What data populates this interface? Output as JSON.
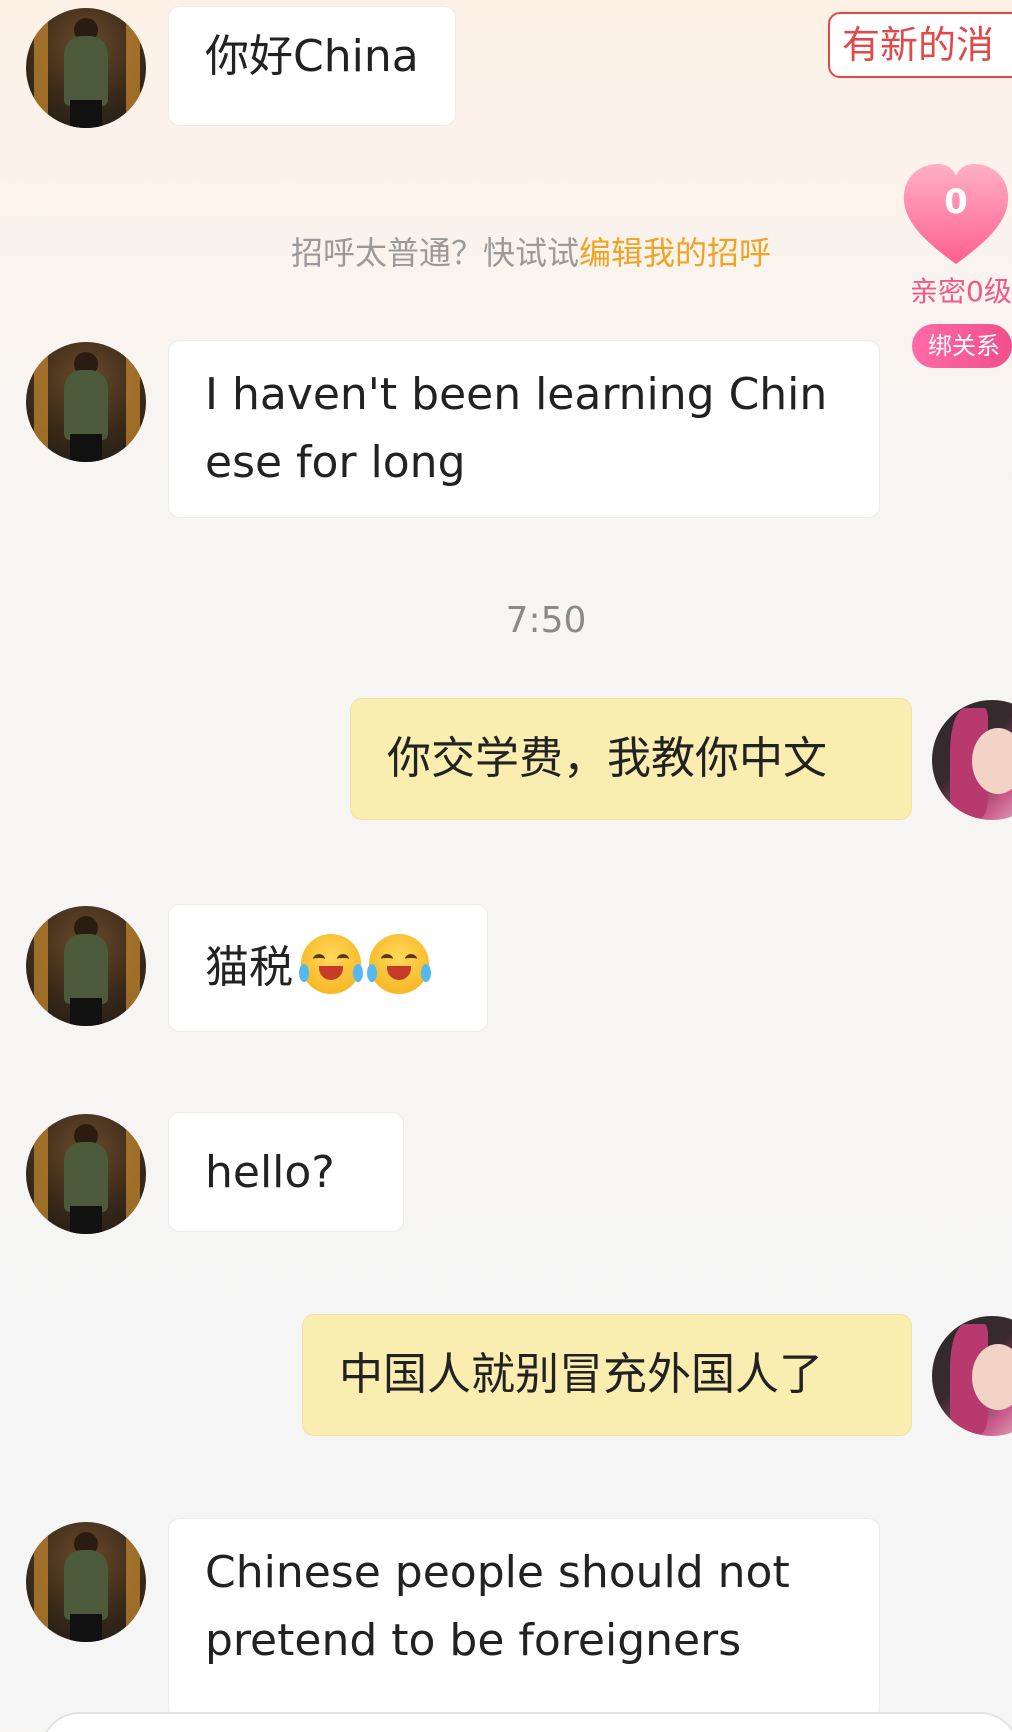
{
  "top_badge": {
    "label": "有新的消"
  },
  "greeting_hint": {
    "prefix": "招呼太普通？快试试",
    "link": "编辑我的招呼"
  },
  "intimacy": {
    "heart_value": "0",
    "label": "亲密0级",
    "bind_label": "绑关系"
  },
  "colors": {
    "self_bubble": "#faedb0",
    "link_orange": "#f0a326",
    "pink": "#ef5a86"
  },
  "messages": [
    {
      "text": "你好China"
    },
    {
      "text": "I haven't been learning Chinese for long"
    },
    {
      "text": "你交学费，我教你中文"
    },
    {
      "text": "猫税"
    },
    {
      "text": "hello?"
    },
    {
      "text": "中国人就别冒充外国人了"
    },
    {
      "text": "Chinese people should not pretend to be foreigners"
    }
  ],
  "timestamp": "7:50",
  "icons": [
    "avatar-contact",
    "avatar-self",
    "heart-icon",
    "laugh-cry-emoji"
  ]
}
